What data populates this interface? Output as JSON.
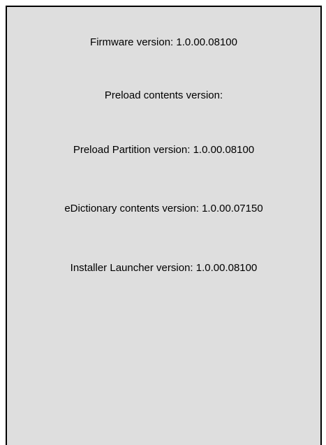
{
  "versions": [
    {
      "text": "Firmware version: 1.0.00.08100"
    },
    {
      "text": "Preload contents version:"
    },
    {
      "text": "Preload Partition version: 1.0.00.08100"
    },
    {
      "text": "eDictionary contents version: 1.0.00.07150"
    },
    {
      "text": "Installer Launcher version: 1.0.00.08100"
    }
  ],
  "colors": {
    "panel_background": "#dedede",
    "border": "#000000",
    "text": "#000000"
  }
}
